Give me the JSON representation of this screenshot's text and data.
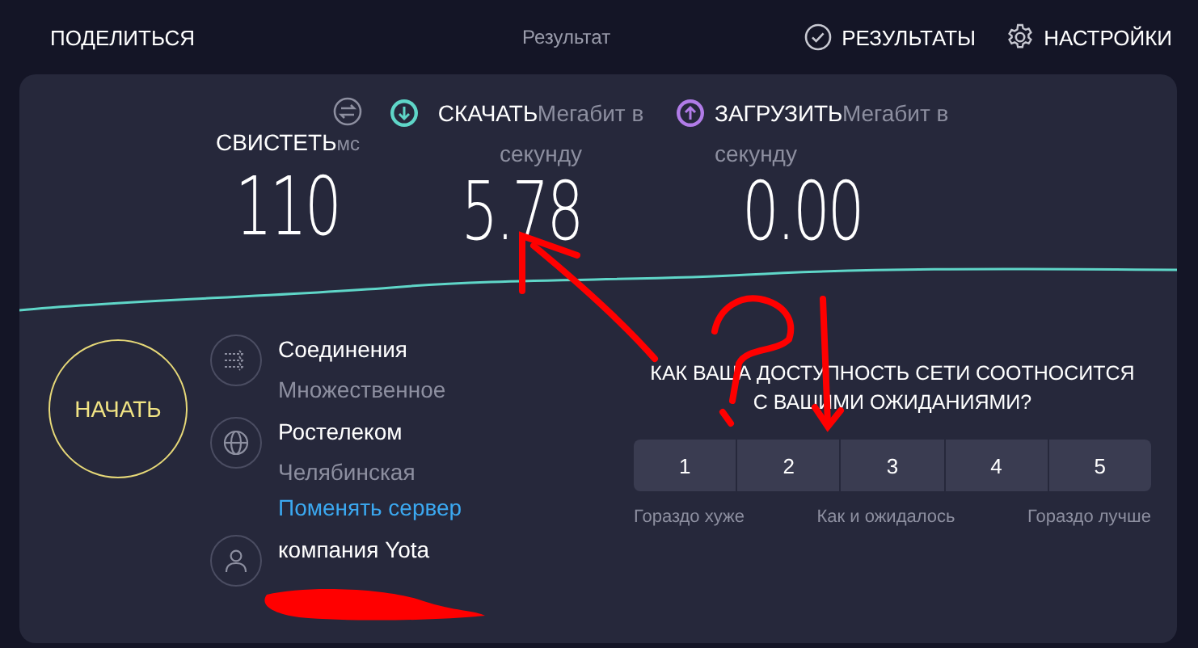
{
  "top_bar": {
    "share": "ПОДЕЛИТЬСЯ",
    "title": "Результат",
    "results": "РЕЗУЛЬТАТЫ",
    "settings": "НАСТРОЙКИ"
  },
  "metrics": [
    {
      "kind": "ping",
      "label": "СВИСТЕТЬ",
      "unit": "мс",
      "value": "110"
    },
    {
      "kind": "download",
      "label": "СКАЧАТЬ",
      "unit": "Мегабит в секунду",
      "value": "5.78"
    },
    {
      "kind": "upload",
      "label": "ЗАГРУЗИТЬ",
      "unit": "Мегабит в секунду",
      "value": "0.00"
    }
  ],
  "start_button": "НАЧАТЬ",
  "info": [
    {
      "kind": "connections",
      "title": "Соединения",
      "subtitle": "Множественное"
    },
    {
      "kind": "server",
      "title": "Ростелеком",
      "subtitle": "Челябинская",
      "link": "Поменять сервер"
    },
    {
      "kind": "provider",
      "title": "компания Yota"
    }
  ],
  "survey": {
    "question": "КАК ВАША ДОСТУПНОСТЬ СЕТИ СООТНОСИТСЯ С ВАШИМИ ОЖИДАНИЯМИ?",
    "options": [
      "1",
      "2",
      "3",
      "4",
      "5"
    ],
    "scale_labels": [
      "Гораздо хуже",
      "Как и ожидалось",
      "Гораздо лучше"
    ]
  }
}
